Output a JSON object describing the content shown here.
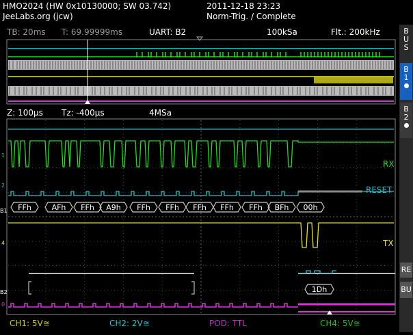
{
  "header": {
    "model": "HMO2024 (HW 0x10130000; SW 03.742)",
    "owner": "JeeLabs.org (jcw)",
    "datetime": "2011-12-18 23:23",
    "trigger": "Norm-Trig. / Complete"
  },
  "status": {
    "tb": "TB: 20ms",
    "t": "T: 69.99999ms",
    "uart": "UART: B2",
    "samplerate": "100kSa",
    "filter": "Flt.: 200kHz"
  },
  "zoom_status": {
    "z": "Z: 100µs",
    "tz": "Tz: -400µs",
    "samplerate": "4MSa"
  },
  "sidebar": {
    "bus_label": "BUS",
    "b1": "B1",
    "b2": "B2",
    "re": "RE",
    "bu": "BU"
  },
  "signals": {
    "rx": "RX",
    "reset": "RESET",
    "tx": "TX",
    "b1_marker": "B1",
    "b2_marker": "B2"
  },
  "bus1_frames": [
    "FFh",
    "AFh",
    "FFh",
    "A9h",
    "FFh",
    "FFh",
    "FFh",
    "FFh",
    "FFh",
    "BFh",
    "00h"
  ],
  "bus2_frames": [
    "1Dh"
  ],
  "bottom": {
    "ch1": "CH1: 5V≅",
    "ch2": "CH2: 2V≅",
    "pod": "POD: TTL",
    "ch4": "CH4: 5V≅"
  },
  "colors": {
    "green": "#22dd22",
    "cyan": "#22c4cc",
    "yellow": "#e8e020",
    "magenta": "#e030e0",
    "grey": "#c8c8c8"
  }
}
